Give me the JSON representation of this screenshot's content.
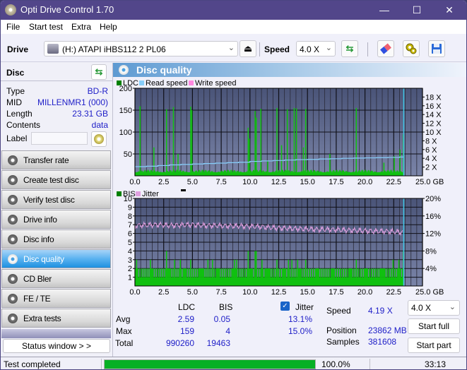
{
  "window": {
    "title": "Opti Drive Control 1.70",
    "minimize": "—",
    "maximize": "☐",
    "close": "✕"
  },
  "menu": [
    "File",
    "Start test",
    "Extra",
    "Help"
  ],
  "toolbar": {
    "drive_label": "Drive",
    "drive_value": "(H:)   ATAPI iHBS112   2 PL06",
    "speed_label": "Speed",
    "speed_value": "4.0 X",
    "eject_icon": "⏏",
    "refresh_icon": "⇆",
    "erase_icon": "eraser",
    "settings_icon": "gears",
    "save_icon": "floppy"
  },
  "disc": {
    "header": "Disc",
    "rows": [
      {
        "key": "Type",
        "value": "BD-R"
      },
      {
        "key": "MID",
        "value": "MILLENMR1 (000)"
      },
      {
        "key": "Length",
        "value": "23.31 GB"
      },
      {
        "key": "Contents",
        "value": "data"
      }
    ],
    "label_key": "Label",
    "label_value": ""
  },
  "nav": {
    "items": [
      {
        "label": "Transfer rate",
        "active": false
      },
      {
        "label": "Create test disc",
        "active": false
      },
      {
        "label": "Verify test disc",
        "active": false
      },
      {
        "label": "Drive info",
        "active": false
      },
      {
        "label": "Disc info",
        "active": false
      },
      {
        "label": "Disc quality",
        "active": true
      },
      {
        "label": "CD Bler",
        "active": false
      },
      {
        "label": "FE / TE",
        "active": false
      },
      {
        "label": "Extra tests",
        "active": false
      }
    ],
    "status_window": "Status window > >"
  },
  "main": {
    "title": "Disc quality"
  },
  "chart_data": [
    {
      "type": "bar",
      "title": "LDC / Read speed",
      "legend": [
        {
          "name": "LDC",
          "color": "#008000"
        },
        {
          "name": "Read speed",
          "color": "#87cefa"
        },
        {
          "name": "Write speed",
          "color": "#ff88e0"
        }
      ],
      "legend_position": "top-left",
      "xlabel": "GB",
      "x_ticks": [
        "0.0",
        "2.5",
        "5.0",
        "7.5",
        "10.0",
        "12.5",
        "15.0",
        "17.5",
        "20.0",
        "22.5",
        "25.0 GB"
      ],
      "xlim": [
        0,
        25
      ],
      "ylim_left": [
        0,
        200
      ],
      "y_ticks_left": [
        "200",
        "150",
        "100",
        "50"
      ],
      "ylim_right": [
        0,
        20
      ],
      "y_ticks_right": [
        "18 X",
        "16 X",
        "14 X",
        "12 X",
        "10 X",
        "8 X",
        "6 X",
        "4 X",
        "2 X"
      ],
      "grid": true,
      "disc_end_gb": 23.31,
      "ldc_baseline_approx": 8,
      "ldc_spikes": [
        {
          "x": 0.4,
          "y": 159
        },
        {
          "x": 1.6,
          "y": 65
        },
        {
          "x": 2.7,
          "y": 152
        },
        {
          "x": 3.3,
          "y": 157
        },
        {
          "x": 3.7,
          "y": 50
        },
        {
          "x": 4.8,
          "y": 158
        },
        {
          "x": 4.9,
          "y": 150
        },
        {
          "x": 9.8,
          "y": 110
        },
        {
          "x": 9.9,
          "y": 85
        },
        {
          "x": 10.4,
          "y": 148
        },
        {
          "x": 10.5,
          "y": 133
        },
        {
          "x": 10.9,
          "y": 153
        },
        {
          "x": 11.5,
          "y": 35
        },
        {
          "x": 12.3,
          "y": 155
        },
        {
          "x": 12.7,
          "y": 70
        },
        {
          "x": 13.2,
          "y": 152
        },
        {
          "x": 13.8,
          "y": 155
        },
        {
          "x": 14.0,
          "y": 154
        },
        {
          "x": 14.6,
          "y": 65
        },
        {
          "x": 14.8,
          "y": 153
        },
        {
          "x": 16.9,
          "y": 50
        },
        {
          "x": 19.2,
          "y": 155
        },
        {
          "x": 21.6,
          "y": 30
        },
        {
          "x": 22.5,
          "y": 45
        },
        {
          "x": 23.0,
          "y": 60
        },
        {
          "x": 23.3,
          "y": 95
        }
      ],
      "read_speed": {
        "x": [
          0,
          1,
          2,
          3,
          4,
          5,
          6,
          7,
          8,
          9,
          10,
          11,
          12,
          13,
          14,
          15,
          16,
          17,
          18,
          19,
          20,
          21,
          22,
          23,
          23.31
        ],
        "y": [
          2.1,
          2.2,
          2.35,
          2.5,
          2.6,
          2.7,
          2.8,
          2.9,
          3.0,
          3.1,
          3.3,
          3.4,
          3.5,
          3.6,
          3.7,
          3.75,
          3.85,
          3.9,
          4.0,
          4.05,
          4.1,
          4.15,
          4.2,
          4.3,
          4.4
        ]
      }
    },
    {
      "type": "bar",
      "title": "BIS / Jitter",
      "legend": [
        {
          "name": "BIS",
          "color": "#008000"
        },
        {
          "name": "Jitter",
          "color": "#e0a0e0"
        }
      ],
      "legend_position": "top-left",
      "xlabel": "GB",
      "x_ticks": [
        "0.0",
        "2.5",
        "5.0",
        "7.5",
        "10.0",
        "12.5",
        "15.0",
        "17.5",
        "20.0",
        "22.5",
        "25.0 GB"
      ],
      "xlim": [
        0,
        25
      ],
      "ylim_left": [
        0,
        10
      ],
      "y_ticks_left": [
        "10",
        "9",
        "8",
        "7",
        "6",
        "5",
        "4",
        "3",
        "2",
        "1"
      ],
      "ylim_right": [
        0,
        20
      ],
      "y_ticks_right": [
        "20%",
        "16%",
        "12%",
        "8%",
        "4%"
      ],
      "grid": true,
      "disc_end_gb": 23.31,
      "bis_baseline": 1,
      "bis_common_level": 2,
      "bis_spikes": [
        {
          "x": 0.1,
          "y": 3
        },
        {
          "x": 1.3,
          "y": 3
        },
        {
          "x": 2.7,
          "y": 4
        },
        {
          "x": 3.4,
          "y": 3
        },
        {
          "x": 3.9,
          "y": 3
        },
        {
          "x": 4.8,
          "y": 3
        },
        {
          "x": 6.3,
          "y": 3
        },
        {
          "x": 6.7,
          "y": 3
        },
        {
          "x": 8.6,
          "y": 3
        },
        {
          "x": 8.8,
          "y": 3
        },
        {
          "x": 9.8,
          "y": 4
        },
        {
          "x": 10.4,
          "y": 4
        },
        {
          "x": 10.5,
          "y": 4
        },
        {
          "x": 11.0,
          "y": 3
        },
        {
          "x": 12.3,
          "y": 3
        },
        {
          "x": 13.3,
          "y": 3
        },
        {
          "x": 13.6,
          "y": 3
        },
        {
          "x": 14.1,
          "y": 3
        },
        {
          "x": 14.8,
          "y": 3
        },
        {
          "x": 19.2,
          "y": 3
        },
        {
          "x": 22.4,
          "y": 3
        },
        {
          "x": 22.9,
          "y": 3
        },
        {
          "x": 23.3,
          "y": 4
        }
      ],
      "jitter_percent": {
        "x": [
          0,
          1,
          2,
          3,
          4,
          5,
          6,
          7,
          8,
          9,
          10,
          11,
          12,
          13,
          14,
          15,
          16,
          17,
          18,
          19,
          20,
          21,
          22,
          23,
          23.31
        ],
        "y": [
          13.8,
          13.9,
          14.0,
          13.8,
          13.9,
          14.0,
          13.8,
          13.8,
          13.7,
          13.7,
          13.6,
          13.5,
          13.3,
          13.2,
          13.1,
          13.0,
          12.9,
          12.9,
          12.8,
          12.7,
          12.6,
          12.5,
          12.5,
          12.3,
          12.2
        ]
      }
    }
  ],
  "stats": {
    "col_ldc": "LDC",
    "col_bis": "BIS",
    "jitter_label": "Jitter",
    "jitter_checked": true,
    "rows": [
      {
        "label": "Avg",
        "ldc": "2.59",
        "bis": "0.05",
        "jitter": "13.1%"
      },
      {
        "label": "Max",
        "ldc": "159",
        "bis": "4",
        "jitter": "15.0%"
      },
      {
        "label": "Total",
        "ldc": "990260",
        "bis": "19463",
        "jitter": ""
      }
    ],
    "speed_label": "Speed",
    "speed_value": "4.19 X",
    "position_label": "Position",
    "position_value": "23862 MB",
    "samples_label": "Samples",
    "samples_value": "381608",
    "speed_select": "4.0 X",
    "start_full": "Start full",
    "start_part": "Start part"
  },
  "statusbar": {
    "status": "Test completed",
    "progress_percent": 100,
    "progress_text": "100.0%",
    "time": "33:13"
  }
}
